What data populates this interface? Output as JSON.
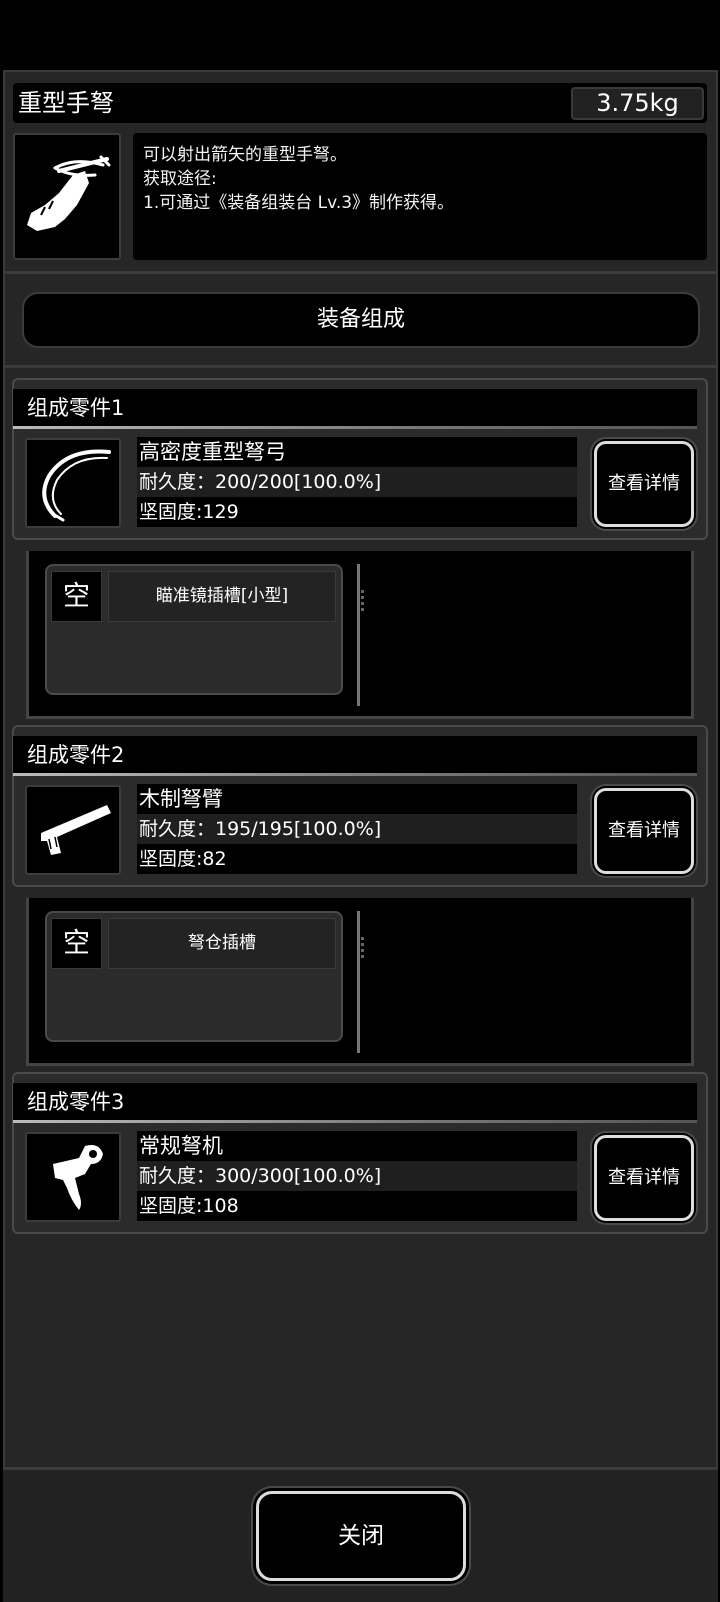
{
  "item": {
    "name": "重型手弩",
    "weight": "3.75kg",
    "description": [
      "可以射出箭矢的重型手弩。",
      "获取途径:",
      "1.可通过《装备组装台 Lv.3》制作获得。"
    ],
    "icon": "crossbow-hand-icon"
  },
  "composition_button": "装备组成",
  "parts": [
    {
      "header": "组成零件1",
      "icon": "crossbow-bow-icon",
      "name": "高密度重型弩弓",
      "durability": "耐久度：200/200[100.0%]",
      "hardness": "坚固度:129",
      "detail_button": "查看详情",
      "slot_empty": "空",
      "slot_name": "瞄准镜插槽[小型]"
    },
    {
      "header": "组成零件2",
      "icon": "crossbow-stock-icon",
      "name": "木制弩臂",
      "durability": "耐久度：195/195[100.0%]",
      "hardness": "坚固度:82",
      "detail_button": "查看详情",
      "slot_empty": "空",
      "slot_name": "弩仓插槽"
    },
    {
      "header": "组成零件3",
      "icon": "crossbow-trigger-icon",
      "name": "常规弩机",
      "durability": "耐久度：300/300[100.0%]",
      "hardness": "坚固度:108",
      "detail_button": "查看详情"
    }
  ],
  "close_button": "关闭"
}
